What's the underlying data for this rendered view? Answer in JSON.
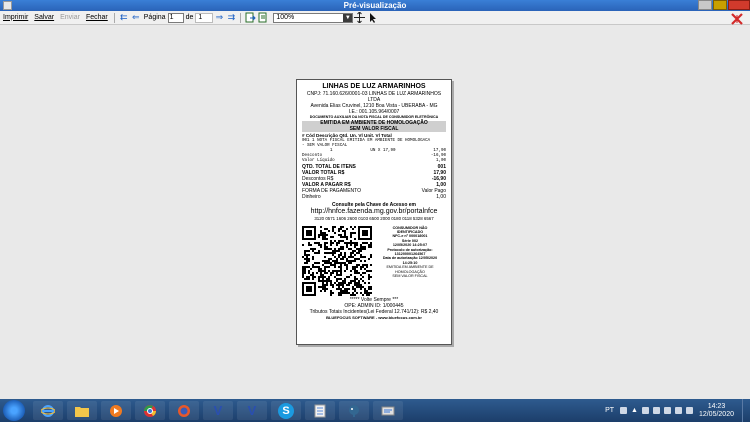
{
  "window": {
    "title": "Pré-visualização"
  },
  "toolbar": {
    "print": "Imprimir",
    "save": "Salvar",
    "send": "Enviar",
    "close": "Fechar",
    "page_label": "Página",
    "page_value": "1",
    "of_label": "de",
    "page_total": "1",
    "zoom": "100%"
  },
  "receipt": {
    "company": "LINHAS DE LUZ ARMARINHOS",
    "cnpj_line1": "CNPJ: 71.160.626/0001-03 LINHAS DE LUZ ARMARINHOS",
    "cnpj_line2": "LTDA",
    "address": "Avenida Elias Cruvinel, 1210 Boa Vista - UBERABA - MG",
    "ie": "I.E.: 001.105.964/0007",
    "doc_aux": "DOCUMENTO AUXILIAR DA NOTA FISCAL DE CONSUMIDOR ELETRÔNICA",
    "homolog1": "EMITIDA EM AMBIENTE DE HOMOLOGAÇÃO",
    "homolog2": "SEM VALOR FISCAL",
    "col_headers": "#  Cód  Descrição  Qtd.  Un.  Vl Unit.  Vl Total",
    "item_line1": "001 1 NOTA FISCAL EMITIDA EM AMBIENTE DE HOMOLOGACA",
    "item_line2": "- SEM VALOR FISCAL",
    "item_qty": "1",
    "item_un": "UN X 17,90",
    "item_total": "17,90",
    "desc_label": "Desconto",
    "desc_value": "-16,90",
    "liq_label": "Valor Líquido",
    "liq_value": "1,00",
    "qtd_label": "QTD. TOTAL DE ITENS",
    "qtd_value": "001",
    "total_label": "VALOR TOTAL R$",
    "total_value": "17,90",
    "descontos_label": "Descontos R$",
    "descontos_value": "-16,90",
    "pagar_label": "VALOR A PAGAR R$",
    "pagar_value": "1,00",
    "forma_label": "FORMA DE PAGAMENTO",
    "forma_value": "Valor Pago",
    "dinheiro_label": "Dinheiro",
    "dinheiro_value": "1,00",
    "consulte": "Consulte pela Chave de Acesso em",
    "url": "http://hnfce.fazenda.mg.gov.br/portalnfce",
    "key": "3120 0571 1606 2600 0103 6500 2000 0180 0118 5328 6567",
    "cons_title1": "CONSUMIDOR NÃO",
    "cons_title2": "IDENTIFICADO",
    "nfce_no": "NFC-e nº 000018001",
    "serie": "Série 002",
    "date": "12/05/2020 14:25:07",
    "protocolo_label": "Protocolo de autorização:",
    "protocolo": "131200001264567",
    "data_aut_label": "Data de autorização 12/05/2020",
    "data_aut_time": "14:25:10",
    "emitida1": "EMITIDA EM AMBIENTE DE",
    "emitida2": "HOMOLOGAÇÃO",
    "emitida3": "SEM VALOR FISCAL",
    "volte": "***** Volte Sempre ***",
    "ope": "OPE: ADMIN ID: 1/000445",
    "tributos": "Tributos Totais Incidentes(Lei Federal 12.741/12): R$ 2,40",
    "software": "BLUEFOCUS SOFTWARE - www.bluefocus.com.br"
  },
  "tray": {
    "lang": "PT",
    "time": "14:23",
    "date": "12/05/2020"
  },
  "taskbar": {
    "v1": "V",
    "v2": "V",
    "s": "S"
  },
  "colors": {
    "titlebar": "#2a63b8",
    "accent": "#1a5fc4"
  }
}
